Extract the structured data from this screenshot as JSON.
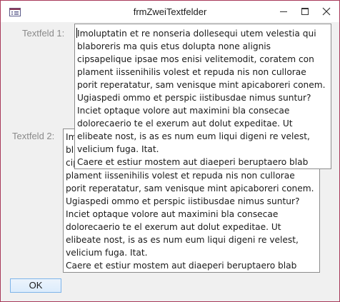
{
  "window": {
    "title": "frmZweiTextfelder",
    "border_color": "#a83a5a"
  },
  "icons": {
    "app": "form-icon",
    "minimize": "minimize-icon",
    "maximize": "maximize-icon",
    "close": "close-icon"
  },
  "form": {
    "label1": "Textfeld 1:",
    "label2": "Textfeld 2:",
    "textfield1_value": "Imoluptatin et re nonseria dollesequi utem velestia qui\nblaboreris ma quis etus dolupta none alignis\ncipsapelique ipsae mos enisi velitemodit, coratem con\nplament iissenihilis volest et repuda nis non cullorae\nporit reperatatur, sam venisque mint apicaboreri conem.\nUgiaspedi ommo et perspic iistibusdae nimus suntur?\nInciet optaque volore aut maximini bla consecae\ndolorecaerio te el exerum aut dolut expeditae. Ut\nelibeate nost, is as es num eum liqui digeni re velest,\nvelicium fuga. Itat.\nCaere et estiur mostem aut diaeperi beruptaero blab",
    "textfield2_value": "Imoluptatin et re nonseria dollesequi utem velestia qui\nblaboreris ma quis etus dolupta none alignis\ncipsapelique ipsae mos enisi velitemodit, coratem con\nplament iissenihilis volest et repuda nis non cullorae\nporit reperatatur, sam venisque mint apicaboreri conem.\nUgiaspedi ommo et perspic iistibusdae nimus suntur?\nInciet optaque volore aut maximini bla consecae\ndolorecaerio te el exerum aut dolut expeditae. Ut\nelibeate nost, is as es num eum liqui digeni re velest,\nvelicium fuga. Itat.\nCaere et estiur mostem aut diaeperi beruptaero blab",
    "ok_label": "OK"
  }
}
